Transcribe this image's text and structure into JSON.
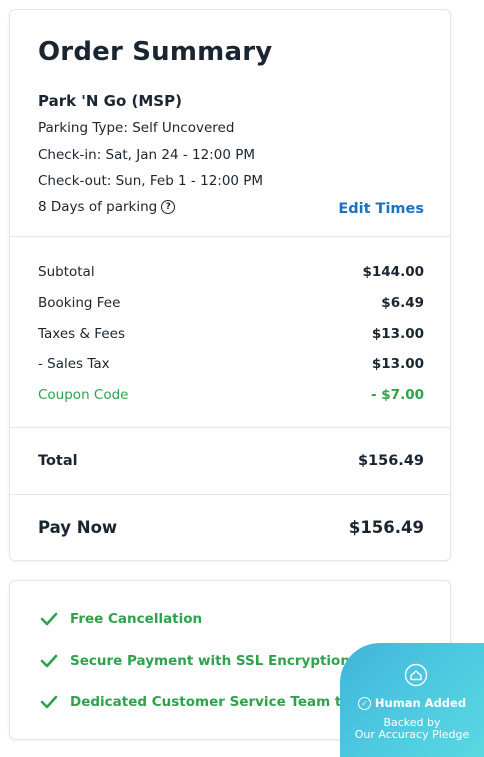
{
  "summary": {
    "title": "Order Summary",
    "lot_name": "Park 'N Go (MSP)",
    "parking_type": "Parking Type: Self Uncovered",
    "check_in": "Check-in: Sat, Jan 24 - 12:00 PM",
    "check_out": "Check-out: Sun, Feb 1 - 12:00 PM",
    "days": "8 Days of parking",
    "edit_times": "Edit Times"
  },
  "charges": [
    {
      "label": "Subtotal",
      "amount": "$144.00"
    },
    {
      "label": "Booking Fee",
      "amount": "$6.49"
    },
    {
      "label": "Taxes & Fees",
      "amount": "$13.00"
    },
    {
      "label": "- Sales Tax",
      "amount": "$13.00"
    },
    {
      "label": "Coupon Code",
      "amount": "- $7.00"
    }
  ],
  "total": {
    "label": "Total",
    "amount": "$156.49"
  },
  "pay_now": {
    "label": "Pay Now",
    "amount": "$156.49"
  },
  "features": [
    "Free Cancellation",
    "Secure Payment with SSL Encryption",
    "Dedicated Customer Service Team to Help"
  ],
  "badge": {
    "title": "Human Added",
    "line1": "Backed by",
    "line2": "Our Accuracy Pledge"
  },
  "colors": {
    "accent_green": "#2ea24c",
    "link_blue": "#1a72c4",
    "badge_teal": "#4cc7e0"
  }
}
